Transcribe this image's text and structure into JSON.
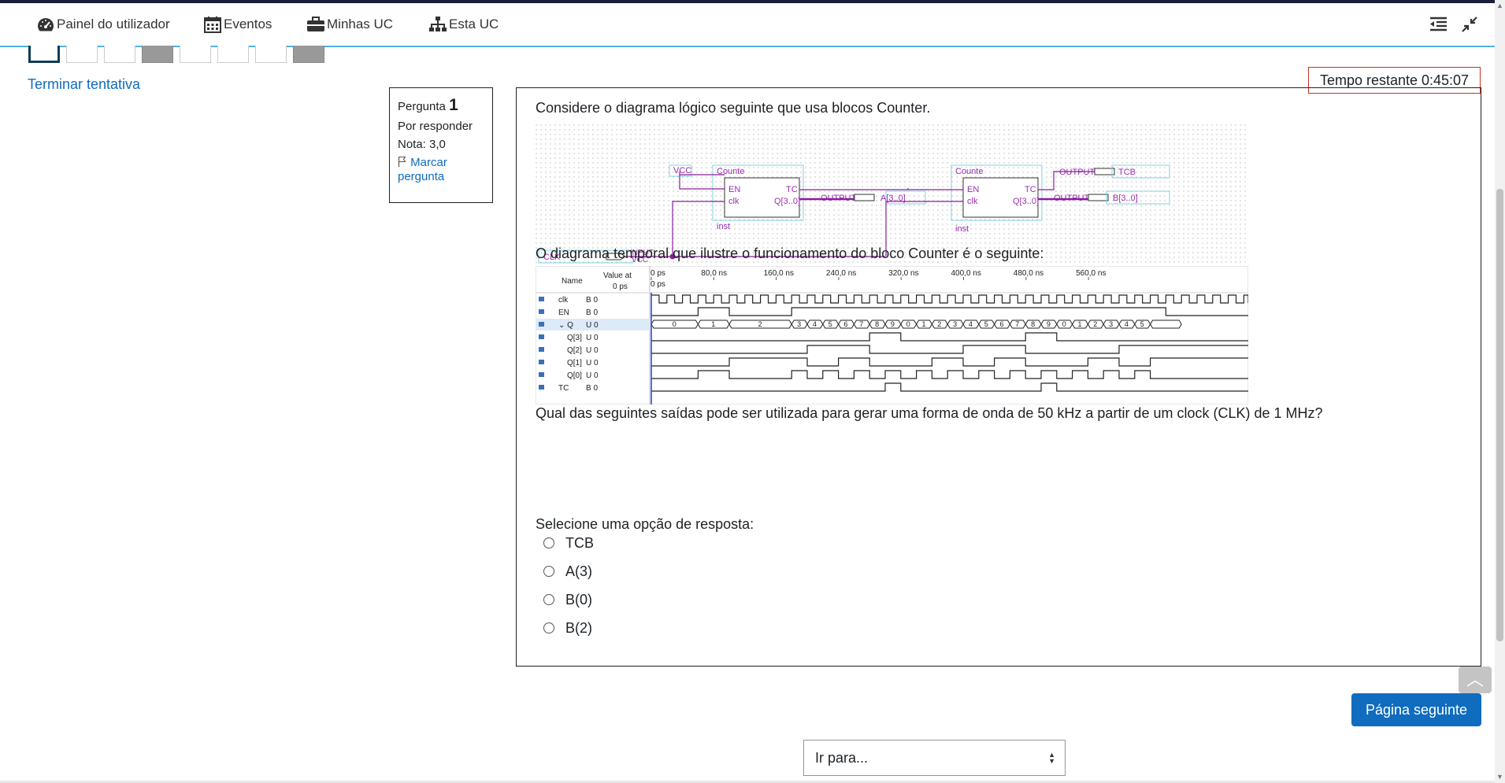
{
  "nav": {
    "items": [
      {
        "label": "Painel do utilizador",
        "icon": "dashboard-icon"
      },
      {
        "label": "Eventos",
        "icon": "calendar-icon"
      },
      {
        "label": "Minhas UC",
        "icon": "briefcase-icon"
      },
      {
        "label": "Esta UC",
        "icon": "sitemap-icon"
      }
    ]
  },
  "quiz_nav": {
    "finish_label": "Terminar tentativa",
    "boxes": [
      "current",
      "empty",
      "empty",
      "answered",
      "empty",
      "empty",
      "empty",
      "answered"
    ]
  },
  "timer": {
    "text": "Tempo restante 0:45:07"
  },
  "question_info": {
    "label": "Pergunta",
    "number": "1",
    "status": "Por responder",
    "grade": "Nota: 3,0",
    "flag_label": "Marcar pergunta"
  },
  "question": {
    "intro": "Considere o diagrama lógico seguinte que usa blocos Counter.",
    "timing_intro": "O diagrama temporal que ilustre o funcionamento do bloco Counter é o seguinte:",
    "prompt": "Qual das seguintes saídas pode ser utilizada para gerar uma forma de onda de 50 kHz a partir de um clock (CLK) de 1 MHz?",
    "select_label": "Selecione uma opção de resposta:",
    "options": [
      "TCB",
      "A(3)",
      "B(0)",
      "B(2)"
    ]
  },
  "schematic": {
    "block_label": "Counte",
    "ports": [
      "EN",
      "clk",
      "TC",
      "Q[3..0]"
    ],
    "instances": [
      "inst",
      "inst"
    ],
    "vcc": "VCC",
    "output": "OUTPUT",
    "input": "INPUT",
    "clk": "CLK",
    "outs": [
      "A[3..0]",
      "TCB",
      "B[3..0]"
    ]
  },
  "timing": {
    "header_name": "Name",
    "header_value": "Value at",
    "header_value2": "0 ps",
    "time_labels": [
      "0 ps",
      "80,0 ns",
      "160,0 ns",
      "240,0 ns",
      "320,0 ns",
      "400,0 ns",
      "480,0 ns",
      "560,0 ns"
    ],
    "time_zero": "0 ps",
    "signals": [
      {
        "name": "clk",
        "value": "B 0"
      },
      {
        "name": "EN",
        "value": "B 0"
      },
      {
        "name": "Q",
        "value": "U 0"
      },
      {
        "name": "Q[3]",
        "value": "U 0"
      },
      {
        "name": "Q[2]",
        "value": "U 0"
      },
      {
        "name": "Q[1]",
        "value": "U 0"
      },
      {
        "name": "Q[0]",
        "value": "U 0"
      },
      {
        "name": "TC",
        "value": "B 0"
      }
    ],
    "q_values": [
      "0",
      "1",
      "2",
      "3",
      "4",
      "5",
      "6",
      "7",
      "8",
      "9",
      "0",
      "1",
      "2",
      "3",
      "4",
      "5",
      "6",
      "7",
      "8",
      "9",
      "0",
      "1",
      "2",
      "3",
      "4",
      "5"
    ]
  },
  "footer": {
    "next_label": "Página seguinte",
    "jump_label": "Ir para..."
  }
}
